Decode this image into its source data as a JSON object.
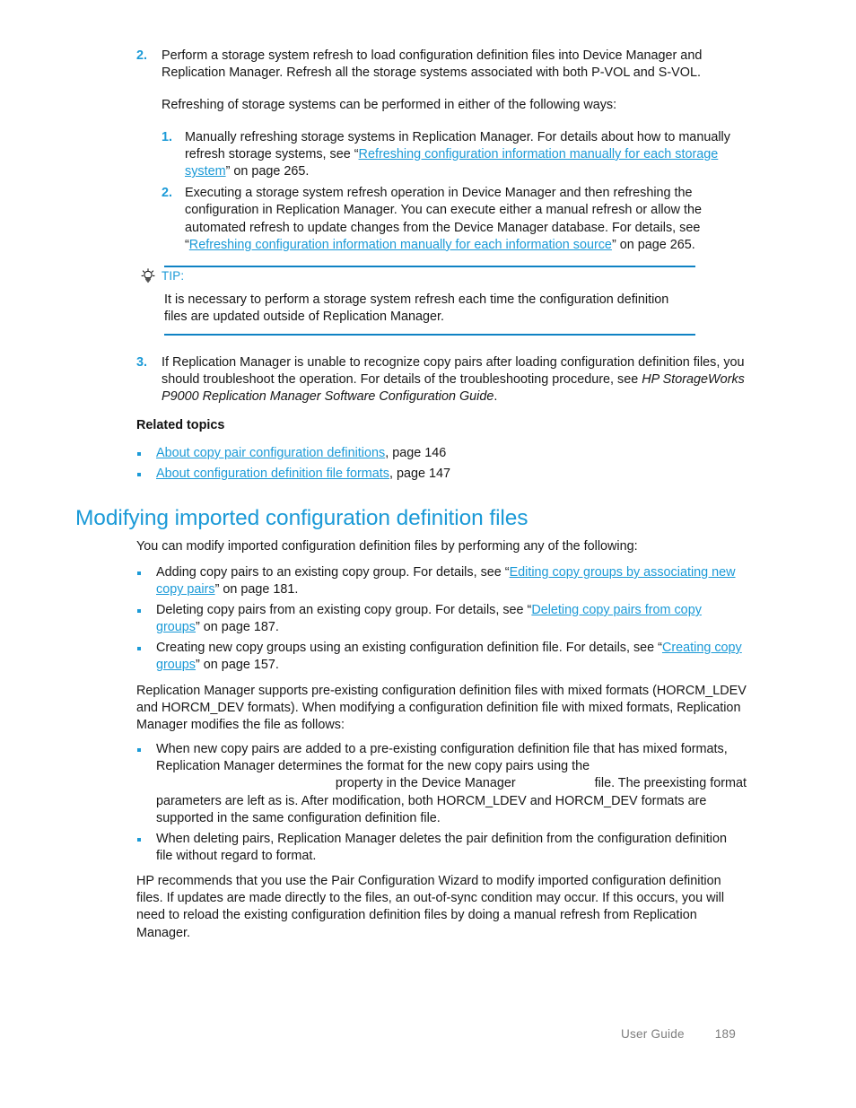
{
  "page": {
    "footer_label": "User Guide",
    "page_number": "189",
    "link_color": "#1b9ad7",
    "heading_color": "#1b9ad7",
    "text_color": "#171717",
    "footer_color": "#7d7d7d"
  },
  "step2": {
    "marker": "2.",
    "para1": "Perform a storage system refresh to load configuration definition files into Device Manager and Replication Manager. Refresh all the storage systems associated with both P-VOL and S-VOL.",
    "para2": "Refreshing of storage systems can be performed in either of the following ways:",
    "substeps": [
      {
        "marker": "1.",
        "text_before": "Manually refreshing storage systems in Replication Manager. For details about how to manually refresh storage systems, see “",
        "link": "Refreshing configuration information manually for each storage system",
        "text_after": "” on page 265."
      },
      {
        "marker": "2.",
        "text_before": "Executing a storage system refresh operation in Device Manager and then refreshing the configuration in Replication Manager. You can execute either a manual refresh or allow the automated refresh to update changes from the Device Manager database. For details, see “",
        "link": "Refreshing configuration information manually for each information source",
        "text_after": "” on page 265."
      }
    ]
  },
  "tip": {
    "icon": "lightbulb-icon",
    "label": "TIP:",
    "body": "It is necessary to perform a storage system refresh each time the configuration definition files are updated outside of Replication Manager."
  },
  "step3": {
    "marker": "3.",
    "text_before": "If Replication Manager is unable to recognize copy pairs after loading configuration definition files, you should troubleshoot the operation. For details of the troubleshooting procedure, see ",
    "italic": "HP StorageWorks P9000 Replication Manager Software Configuration Guide",
    "text_after": "."
  },
  "related": {
    "heading": "Related topics",
    "items": [
      {
        "link": "About copy pair configuration definitions",
        "suffix": ", page 146"
      },
      {
        "link": "About configuration definition file formats",
        "suffix": ", page 147"
      }
    ]
  },
  "section": {
    "heading": "Modifying imported configuration definition files",
    "intro": "You can modify imported configuration definition files by performing any of the following:",
    "bullets": [
      {
        "text_before": "Adding copy pairs to an existing copy group. For details, see “",
        "link": "Editing copy groups by associating new copy pairs",
        "text_after": "” on page 181."
      },
      {
        "text_before": "Deleting copy pairs from an existing copy group. For details, see “",
        "link": "Deleting copy pairs from copy groups",
        "text_after": "” on page 187."
      },
      {
        "text_before": "Creating new copy groups using an existing configuration definition file. For details, see “",
        "link": "Creating copy groups",
        "text_after": "” on page 157."
      }
    ],
    "mixed_formats_para": "Replication Manager supports pre-existing configuration definition files with mixed formats (HORCM_LDEV and HORCM_DEV formats). When modifying a configuration definition file with mixed formats, Replication Manager modifies the file as follows:",
    "format_bullets": [
      {
        "part1": "When new copy pairs are added to a pre-existing configuration definition file that has mixed formats, Replication Manager determines the format for the new copy pairs using the ",
        "gap1": "                                                  ",
        "part2": "property in the Device Manager",
        "gap2": "                      ",
        "part3": "file. The preexisting format parameters are left as is. After modification, both HORCM_LDEV and HORCM_DEV formats are supported in the same configuration definition file."
      },
      {
        "part1": "When deleting pairs, Replication Manager deletes the pair definition from the configuration definition file without regard to format.",
        "gap1": "",
        "part2": "",
        "gap2": "",
        "part3": ""
      }
    ],
    "closing_para": "HP recommends that you use the Pair Configuration Wizard to modify imported configuration definition files. If updates are made directly to the files, an out-of-sync condition may occur. If this occurs, you will need to reload the existing configuration definition files by doing a manual refresh from Replication Manager."
  }
}
